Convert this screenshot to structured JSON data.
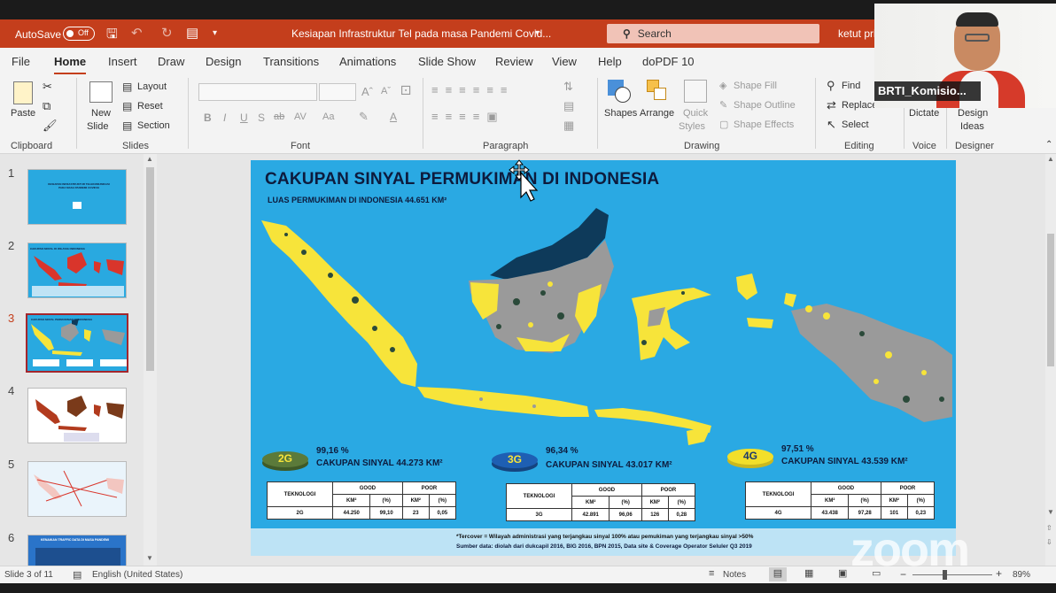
{
  "app": {
    "autosave_label": "AutoSave",
    "autosave_state": "Off",
    "document_title": "Kesiapan Infrastruktur Tel pada masa Pandemi Covid...",
    "search_placeholder": "Search",
    "user_name": "ketut pri",
    "accent_color": "#c43e1c"
  },
  "tabs": [
    {
      "label": "File"
    },
    {
      "label": "Home",
      "active": true
    },
    {
      "label": "Insert"
    },
    {
      "label": "Draw"
    },
    {
      "label": "Design"
    },
    {
      "label": "Transitions"
    },
    {
      "label": "Animations"
    },
    {
      "label": "Slide Show"
    },
    {
      "label": "Review"
    },
    {
      "label": "View"
    },
    {
      "label": "Help"
    },
    {
      "label": "doPDF 10"
    }
  ],
  "ribbon": {
    "clipboard": {
      "paste": "Paste",
      "group": "Clipboard"
    },
    "slides": {
      "new_slide": "New",
      "new_slide2": "Slide",
      "layout": "Layout",
      "reset": "Reset",
      "section": "Section",
      "group": "Slides"
    },
    "font": {
      "group": "Font",
      "buttons": [
        "B",
        "I",
        "U",
        "S",
        "ab",
        "AV",
        "Aa",
        "A",
        "A"
      ]
    },
    "paragraph": {
      "group": "Paragraph"
    },
    "drawing": {
      "shapes": "Shapes",
      "arrange": "Arrange",
      "quick_styles": "Quick",
      "quick_styles2": "Styles",
      "shape_fill": "Shape Fill",
      "shape_outline": "Shape Outline",
      "shape_effects": "Shape Effects",
      "group": "Drawing"
    },
    "editing": {
      "find": "Find",
      "replace": "Replace",
      "select": "Select",
      "group": "Editing"
    },
    "voice": {
      "dictate": "Dictate",
      "group": "Voice"
    },
    "designer": {
      "design_ideas": "Design",
      "design_ideas2": "Ideas",
      "group": "Designer"
    }
  },
  "thumbnails": [
    {
      "number": "1",
      "color": "#29a9e0",
      "caption": "KESIAPAN INFRASTRUKTUR TELEKOMUNIKASI PADA MASA PANDEMI COVID19"
    },
    {
      "number": "2",
      "color": "#29a9e0",
      "caption": "CAKUPAN SINYAL DI WILAYAH INDONESIA"
    },
    {
      "number": "3",
      "color": "#29a9e0",
      "caption": "CAKUPAN SINYAL PERMUKIMAN DI INDONESIA",
      "active": true
    },
    {
      "number": "4",
      "color": "#ffffff",
      "caption": ""
    },
    {
      "number": "5",
      "color": "#eaf4fb",
      "caption": ""
    },
    {
      "number": "6",
      "color": "#29a9e0",
      "caption": "KENAIKAN TRAFFIC DATA DI MASA PANDEMI"
    }
  ],
  "slide": {
    "title": "CAKUPAN SINYAL PERMUKIMAN DI INDONESIA",
    "subtitle": "LUAS PERMUKIMAN DI INDONESIA 44.651 KM²",
    "background": "#2aa9e3",
    "covered_color": "#f7e43a",
    "uncovered_color": "#9a9a9a",
    "forest_color": "#2b4a3a",
    "dark_color": "#0e3a5a",
    "tech": [
      {
        "badge": "2G",
        "badge_color": "#5b7a3a",
        "percent": "99,16 %",
        "coverage": "CAKUPAN SINYAL 44.273 KM²",
        "table": {
          "h_tech": "TEKNOLOGI",
          "h_good": "GOOD",
          "h_poor": "POOR",
          "h_km": "KM²",
          "h_pct": "(%)",
          "tech": "2G",
          "good_km": "44.250",
          "good_pct": "99,10",
          "poor_km": "23",
          "poor_pct": "0,05"
        }
      },
      {
        "badge": "3G",
        "badge_color": "#1e5fb3",
        "percent": "96,34 %",
        "coverage": "CAKUPAN SINYAL 43.017 KM²",
        "table": {
          "h_tech": "TEKNOLOGI",
          "h_good": "GOOD",
          "h_poor": "POOR",
          "h_km": "KM²",
          "h_pct": "(%)",
          "tech": "3G",
          "good_km": "42.891",
          "good_pct": "96,06",
          "poor_km": "126",
          "poor_pct": "0,28"
        }
      },
      {
        "badge": "4G",
        "badge_color": "#f2df2a",
        "percent": "97,51 %",
        "coverage": "CAKUPAN SINYAL 43.539 KM²",
        "table": {
          "h_tech": "TEKNOLOGI",
          "h_good": "GOOD",
          "h_poor": "POOR",
          "h_km": "KM²",
          "h_pct": "(%)",
          "tech": "4G",
          "good_km": "43.438",
          "good_pct": "97,28",
          "poor_km": "101",
          "poor_pct": "0,23"
        }
      }
    ],
    "footnote1": "*Tercover = Wilayah administrasi yang terjangkau sinyal 100% atau pemukiman yang terjangkau sinyal >50%",
    "footnote2": "Sumber data: diolah dari dukcapil 2016, BIG 2016, BPN 2015, Data site & Coverage Operator Seluler Q3 2019"
  },
  "status": {
    "slide_indicator": "Slide 3 of 11",
    "language": "English (United States)",
    "notes": "Notes",
    "zoom": "89%"
  },
  "video": {
    "participant_name": "BRTI_Komisio...",
    "watermark": "zoom"
  }
}
